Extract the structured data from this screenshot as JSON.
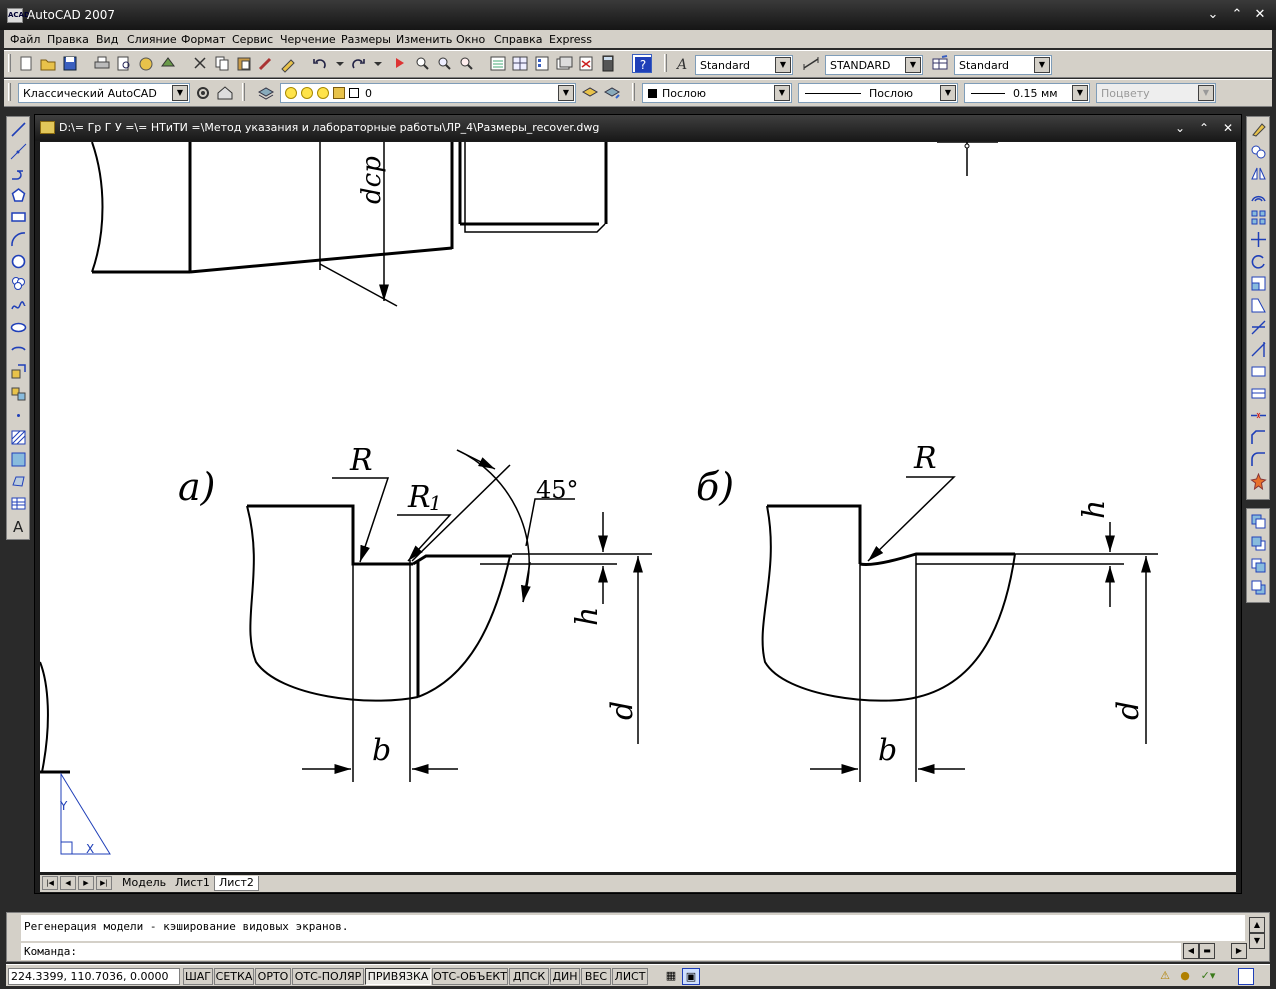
{
  "app": {
    "title": "AutoCAD 2007",
    "icon_label": "ACAD"
  },
  "menu": [
    "Файл",
    "Правка",
    "Вид",
    "Слияние",
    "Формат",
    "Сервис",
    "Черчение",
    "Размеры",
    "Изменить",
    "Окно",
    "Справка",
    "Express"
  ],
  "toolbar_styles": {
    "text_style": "Standard",
    "dim_style": "STANDARD",
    "table_style": "Standard"
  },
  "toolbar_props": {
    "workspace": "Классический AutoCAD",
    "layer": "0",
    "color": "Послою",
    "linetype": "Послою",
    "lineweight": "0.15 мм",
    "plotstyle": "Поцвету"
  },
  "document": {
    "title": "D:\\= Гр Г У =\\= НТиТИ =\\Метод указания и лабораторные работы\\ЛР_4\\Размеры_recover.dwg"
  },
  "drawing": {
    "label_dcp": "dcp",
    "label_a": "a)",
    "label_b_variant": "б)",
    "label_R": "R",
    "label_R1": "R",
    "label_R1_sub": "1",
    "label_45": "45°",
    "label_h": "h",
    "label_d": "d",
    "label_b": "b",
    "ucs_y": "Y",
    "ucs_x": "X"
  },
  "tabs": {
    "model": "Модель",
    "sheet1": "Лист1",
    "sheet2": "Лист2",
    "active": "Лист2"
  },
  "command": {
    "history": "Регенерация модели - кэширование видовых экранов.",
    "prompt": "Команда:"
  },
  "status": {
    "coords": "224.3399, 110.7036, 0.0000",
    "toggles": [
      "ШАГ",
      "СЕТКА",
      "ОРТО",
      "ОТС-ПОЛЯР",
      "ПРИВЯЗКА",
      "ОТС-ОБЪЕКТ",
      "ДПСК",
      "ДИН",
      "ВЕС",
      "ЛИСТ"
    ],
    "toggles_on": [
      false,
      false,
      false,
      false,
      true,
      false,
      false,
      false,
      false,
      false
    ]
  },
  "colors": {
    "accent_blue": "#1f3fb8",
    "canvas_bg": "#ffffff",
    "chrome": "#d4d0c8"
  }
}
